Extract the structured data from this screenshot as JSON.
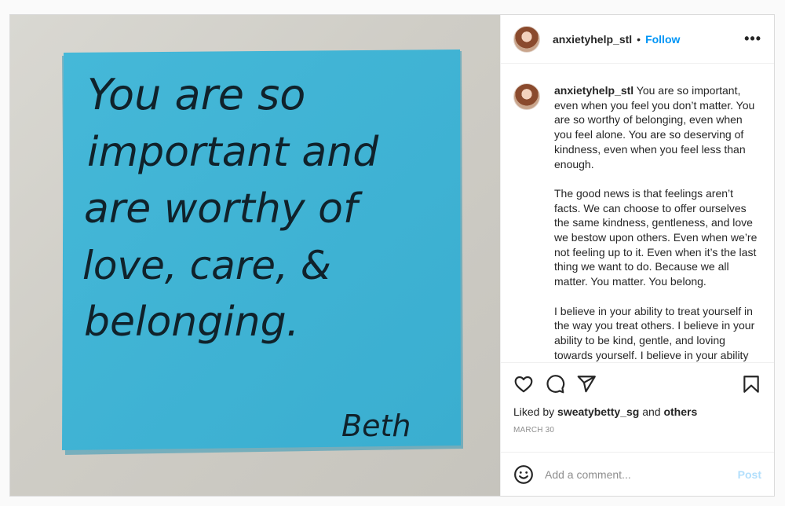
{
  "colors": {
    "accent": "#0095f6",
    "post_disabled": "#b2dffc",
    "note": "#3fb3d4"
  },
  "media": {
    "note_lines": [
      "You are so",
      "important and",
      "are worthy of",
      "love, care, &",
      "belonging."
    ],
    "signature": "Beth"
  },
  "header": {
    "username": "anxietyhelp_stl",
    "separator": "•",
    "follow_label": "Follow",
    "more_label": "•••"
  },
  "caption": {
    "username": "anxietyhelp_stl",
    "paragraph1": "You are so important, even when you feel you don’t matter. You are so worthy of belonging, even when you feel alone. You are so deserving of kindness, even when you feel less than enough.",
    "paragraph2": "The good news is that feelings aren’t facts. We can choose to offer ourselves the same kindness, gentleness, and love we bestow upon others. Even when we’re not feeling up to it. Even when it’s the last thing we want to do. Because we all matter. You matter. You belong.",
    "paragraph3": "I believe in your ability to treat yourself in the way you treat others. I believe in your ability to be kind, gentle, and loving towards yourself. I believe in your ability"
  },
  "actions": {
    "icons": [
      "heart-icon",
      "comment-icon",
      "share-icon",
      "bookmark-icon"
    ],
    "liked_by_prefix": "Liked by",
    "liked_by_user": "sweatybetty_sg",
    "liked_by_and": "and",
    "liked_by_others": "others",
    "date": "MARCH 30"
  },
  "comment": {
    "placeholder": "Add a comment...",
    "post_label": "Post",
    "emoji_icon": "smiley-icon"
  }
}
